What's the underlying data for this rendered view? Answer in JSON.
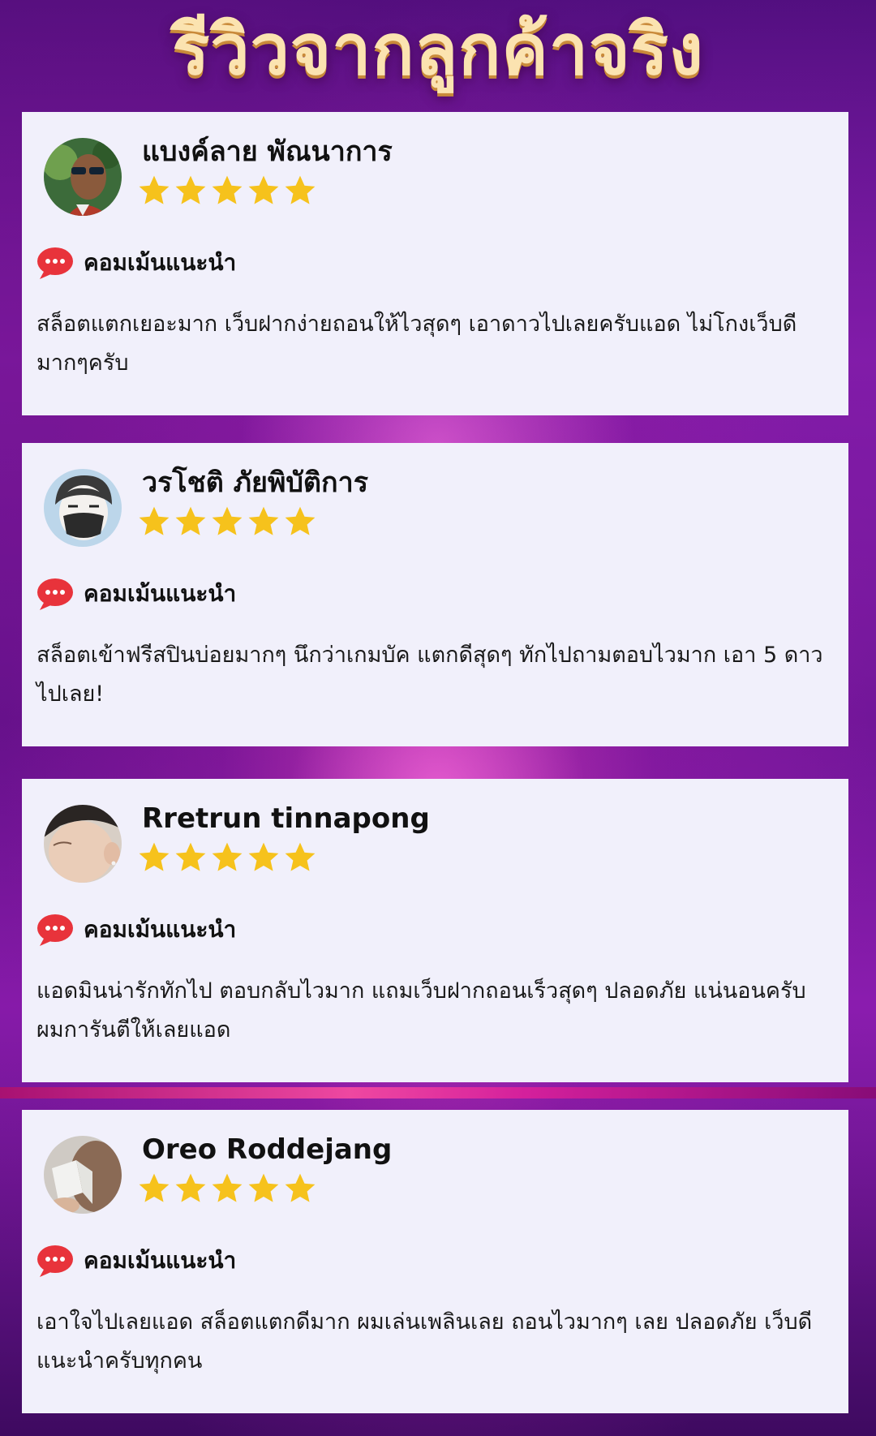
{
  "page": {
    "title": "รีวิวจากลูกค้าจริง"
  },
  "reviews": [
    {
      "name": "แบงค์ลาย พัณนาการ",
      "rating": 5,
      "avatar_icon": "user-photo-sunglasses",
      "comment_label": "คอมเม้นแนะนำ",
      "text": "สล็อตแตกเยอะมาก เว็บฝากง่ายถอนให้ไวสุดๆ เอาดาวไปเลยครับแอด ไม่โกงเว็บดีมากๆครับ"
    },
    {
      "name": "วรโชติ ภัยพิบัติการ",
      "rating": 5,
      "avatar_icon": "user-cartoon-mask",
      "comment_label": "คอมเม้นแนะนำ",
      "text": "สล็อตเข้าฟรีสปินบ่อยมากๆ นึกว่าเกมบัค แตกดีสุดๆ ทักไปถามตอบไวมาก เอา 5 ดาวไปเลย!"
    },
    {
      "name": "Rretrun tinnapong",
      "rating": 5,
      "avatar_icon": "user-photo-profile",
      "comment_label": "คอมเม้นแนะนำ",
      "text": "แอดมินน่ารักทักไป ตอบกลับไวมาก แถมเว็บฝากถอนเร็วสุดๆ ปลอดภัย แน่นอนครับผมการันตีให้เลยแอด"
    },
    {
      "name": "Oreo Roddejang",
      "rating": 5,
      "avatar_icon": "user-photo-reading",
      "comment_label": "คอมเม้นแนะนำ",
      "text": "เอาใจไปเลยแอด สล็อตแตกดีมาก ผมเล่นเพลินเลย ถอนไวมากๆ เลย ปลอดภัย เว็บดีแนะนำครับทุกคน"
    }
  ],
  "colors": {
    "star": "#f6c21c",
    "chat_icon": "#e8333b",
    "card_bg": "#f1f0fb",
    "title": "#fbe3b0"
  },
  "icons": {
    "star": "star-icon",
    "chat": "chat-bubble-icon"
  }
}
